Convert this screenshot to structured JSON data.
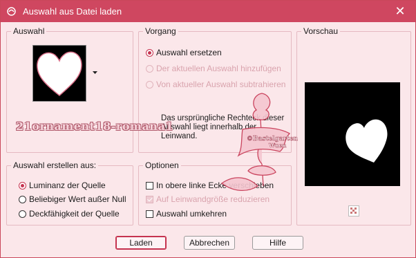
{
  "window": {
    "title": "Auswahl aus Datei laden",
    "close_glyph": "✕"
  },
  "groups": {
    "auswahl": "Auswahl",
    "vorgang": "Vorgang",
    "vorschau": "Vorschau",
    "erstellen": "Auswahl erstellen aus:",
    "optionen": "Optionen"
  },
  "vorgang": {
    "items": [
      {
        "label": "Auswahl ersetzen",
        "selected": true,
        "enabled": true
      },
      {
        "label": "Der aktuellen Auswahl hinzufügen",
        "selected": false,
        "enabled": false
      },
      {
        "label": "Von aktueller Auswahl subtrahieren",
        "selected": false,
        "enabled": false
      }
    ],
    "note": "Das ursprüngliche Rechteck dieser Auswahl liegt innerhalb der Leinwand."
  },
  "erstellen": {
    "items": [
      {
        "label": "Luminanz der Quelle",
        "selected": true
      },
      {
        "label": "Beliebiger Wert außer Null",
        "selected": false
      },
      {
        "label": "Deckfähigkeit der Quelle",
        "selected": false
      }
    ]
  },
  "optionen": {
    "items": [
      {
        "label": "In obere linke Ecke verschieben",
        "checked": false,
        "enabled": true
      },
      {
        "label": "Auf Leinwandgröße reduzieren",
        "checked": true,
        "enabled": false
      },
      {
        "label": "Auswahl umkehren",
        "checked": false,
        "enabled": true
      }
    ]
  },
  "watermark": {
    "name": "21ornament18-romana1",
    "signature_line1": "©Bastelgarten",
    "signature_line2": "Wuen"
  },
  "buttons": {
    "ok": "Laden",
    "cancel": "Abbrechen",
    "help": "Hilfe"
  },
  "colors": {
    "accent": "#cf4760",
    "background": "#fbe7ea",
    "disabled_text": "#d9a3ad"
  }
}
